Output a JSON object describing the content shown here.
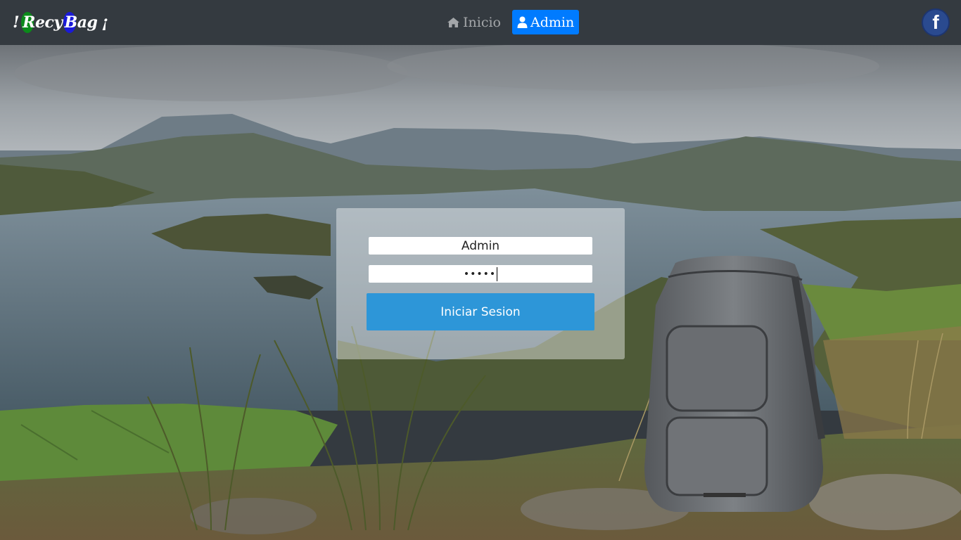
{
  "brand": {
    "open_punct": "!",
    "word1": "Recy",
    "word2": "Bag",
    "close_punct": "¡"
  },
  "nav": {
    "home_label": "Inicio",
    "admin_label": "Admin"
  },
  "social": {
    "facebook_letter": "f"
  },
  "login": {
    "username_value": "Admin",
    "password_mask": "•••••",
    "submit_label": "Iniciar Sesion"
  },
  "colors": {
    "navbar": "#343a40",
    "active_tab": "#007bff",
    "login_button": "#2d96d8",
    "facebook": "#2a4a8f"
  },
  "icons": {
    "home": "home-icon",
    "user": "user-icon",
    "facebook": "facebook-icon"
  }
}
